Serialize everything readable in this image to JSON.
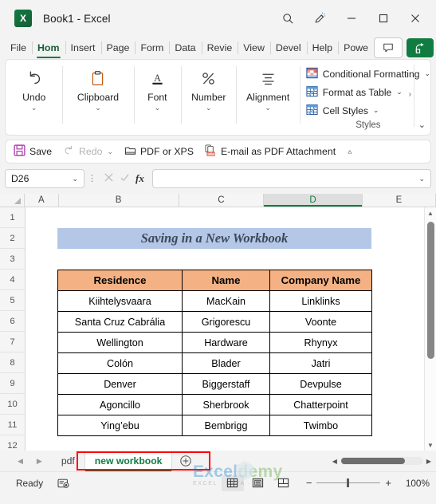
{
  "window": {
    "logo_text": "X",
    "title": "Book1  -  Excel",
    "search_icon": "search-icon",
    "pen_icon": "draw-icon",
    "minimize": "minimize-icon",
    "maximize": "maximize-icon",
    "close": "close-icon"
  },
  "ribbon_tabs": [
    {
      "label": "File",
      "active": false
    },
    {
      "label": "Hom",
      "active": true
    },
    {
      "label": "Insert",
      "active": false
    },
    {
      "label": "Page",
      "active": false
    },
    {
      "label": "Form",
      "active": false
    },
    {
      "label": "Data",
      "active": false
    },
    {
      "label": "Revie",
      "active": false
    },
    {
      "label": "View",
      "active": false
    },
    {
      "label": "Devel",
      "active": false
    },
    {
      "label": "Help",
      "active": false
    },
    {
      "label": "Powe",
      "active": false
    }
  ],
  "tabstrip_right": {
    "comment_label": "Comments",
    "share_label": "Share"
  },
  "ribbon": {
    "groups": [
      {
        "label": "Undo",
        "icon": "undo-arrow-icon",
        "caret": "⌄"
      },
      {
        "label": "Clipboard",
        "icon": "clipboard-icon",
        "caret": "⌄"
      },
      {
        "label": "Font",
        "icon": "font-a-icon",
        "caret": "⌄"
      },
      {
        "label": "Number",
        "icon": "percent-icon",
        "caret": "⌄"
      },
      {
        "label": "Alignment",
        "icon": "alignment-lines-icon",
        "caret": "⌄"
      }
    ],
    "styles": {
      "caption": "Styles",
      "items": [
        {
          "label": "Conditional Formatting",
          "icon": "conditional-formatting-icon",
          "caret": "⌄"
        },
        {
          "label": "Format as Table",
          "icon": "format-as-table-icon",
          "caret": "⌄"
        },
        {
          "label": "Cell Styles",
          "icon": "cell-styles-icon",
          "caret": "⌄"
        }
      ]
    },
    "overflow": "›",
    "collapse": "⌄"
  },
  "qat": {
    "items": [
      {
        "label": "Save",
        "icon": "save-disk-icon",
        "disabled": false,
        "caret": ""
      },
      {
        "label": "Redo",
        "icon": "redo-arrow-icon",
        "disabled": true,
        "caret": "⌄"
      },
      {
        "label": "PDF or XPS",
        "icon": "pdf-or-xps-icon",
        "disabled": false,
        "caret": ""
      },
      {
        "label": "E-mail as PDF Attachment",
        "icon": "email-pdf-icon",
        "disabled": false,
        "caret": ""
      }
    ],
    "more": "⩟"
  },
  "formula_bar": {
    "name_box_value": "D26",
    "name_box_caret": "⌄",
    "cancel_icon": "cancel-x-icon",
    "enter_icon": "confirm-check-icon",
    "fx_icon": "fx",
    "formula_value": "",
    "formula_placeholder": "",
    "expand_caret": "⌄"
  },
  "grid": {
    "columns": [
      {
        "label": "A",
        "width": 44,
        "selected": false
      },
      {
        "label": "B",
        "width": 156,
        "selected": false
      },
      {
        "label": "C",
        "width": 110,
        "selected": false
      },
      {
        "label": "D",
        "width": 128,
        "selected": true
      },
      {
        "label": "E",
        "width": 60,
        "selected": false
      }
    ],
    "rows": [
      "1",
      "2",
      "3",
      "4",
      "5",
      "6",
      "7",
      "8",
      "9",
      "10",
      "11",
      "12"
    ],
    "banner_text": "Saving in a New Workbook",
    "banner_color": "#b4c7e7",
    "table_header_color": "#f4b183",
    "table": {
      "headers": [
        "Residence",
        "Name",
        "Company Name"
      ],
      "rows": [
        [
          "Kiihtelysvaara",
          "MacKain",
          "Linklinks"
        ],
        [
          "Santa Cruz Cabrália",
          "Grigorescu",
          "Voonte"
        ],
        [
          "Wellington",
          "Hardware",
          "Rhynyx"
        ],
        [
          "Colón",
          "Blader",
          "Jatri"
        ],
        [
          "Denver",
          "Biggerstaff",
          "Devpulse"
        ],
        [
          "Agoncillo",
          "Sherbrook",
          "Chatterpoint"
        ],
        [
          "Ying’ebu",
          "Bembrigg",
          "Twimbo"
        ]
      ]
    },
    "scroll_up": "▲",
    "scroll_down": "▼"
  },
  "sheet_tabs": {
    "prev": "◀",
    "next": "▶",
    "tabs": [
      {
        "label": "pdf",
        "active": false
      },
      {
        "label": "new workbook",
        "active": true
      }
    ],
    "add_label": "+",
    "highlight_color": "#ff0000",
    "hscroll_left": "◀",
    "hscroll_right": "▶"
  },
  "status_bar": {
    "state": "Ready",
    "recording_icon": "macro-record-icon",
    "views": [
      {
        "name": "normal-view",
        "active": true
      },
      {
        "name": "page-layout-view",
        "active": false
      },
      {
        "name": "page-break-view",
        "active": false
      }
    ],
    "zoom_out": "−",
    "zoom_in": "+",
    "zoom_level": "100%"
  },
  "watermark": {
    "part1": "Excel",
    "part2": "demy",
    "tagline": "EXCEL · DATA · BI"
  }
}
